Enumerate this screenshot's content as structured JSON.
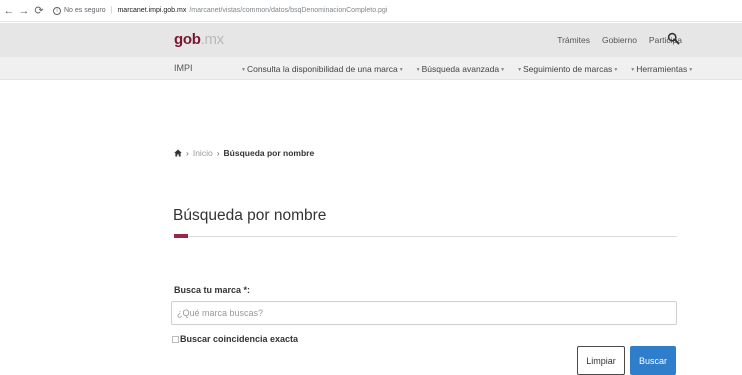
{
  "browser": {
    "security": "No es seguro",
    "url_host": "marcanet.impi.gob.mx",
    "url_path": "/marcanet/vistas/common/datos/bsqDenominacionCompleto.pgi"
  },
  "header": {
    "logo_bold": "gob",
    "logo_light": ".mx",
    "links": [
      "Trámites",
      "Gobierno",
      "Participa"
    ]
  },
  "subheader": {
    "brand": "IMPI",
    "menu": [
      "Consulta la disponibilidad de una marca",
      "Búsqueda avanzada",
      "Seguimiento de marcas",
      "Herramientas"
    ]
  },
  "breadcrumb": {
    "home": "Inicio",
    "current": "Búsqueda por nombre"
  },
  "page": {
    "title": "Búsqueda por nombre"
  },
  "form": {
    "label": "Busca tu marca *:",
    "placeholder": "¿Qué marca buscas?",
    "value": "",
    "exact_match_label": "Buscar coincidencia exacta",
    "exact_match_checked": false,
    "clear_label": "Limpiar",
    "search_label": "Buscar"
  },
  "colors": {
    "accent": "#9d2449",
    "logo": "#7b1630",
    "primary_button": "#2e7ecb"
  }
}
